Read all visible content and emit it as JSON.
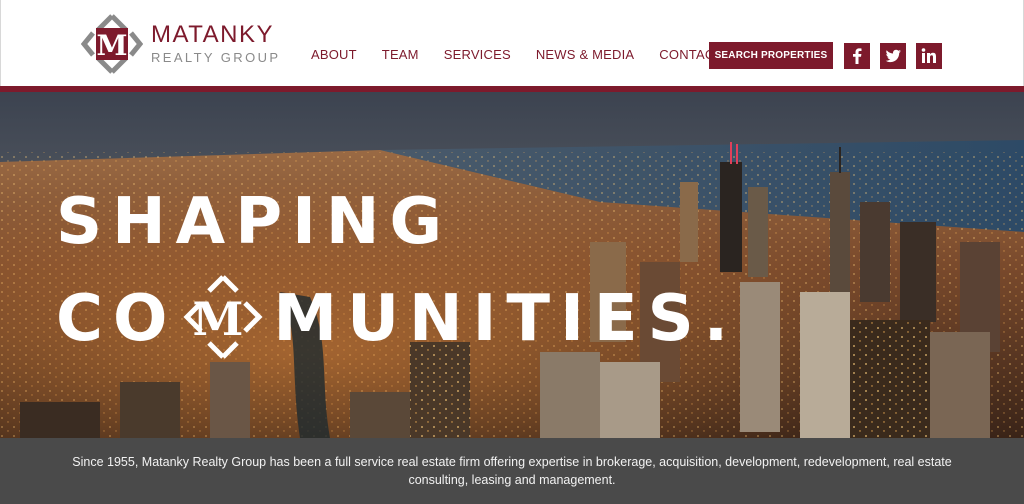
{
  "brand": {
    "name": "MATANKY",
    "subtitle": "REALTY GROUP",
    "logo_letter": "M",
    "primary_color": "#7d1a2c",
    "secondary_color": "#8a8a8a"
  },
  "nav": {
    "items": [
      {
        "label": "ABOUT"
      },
      {
        "label": "TEAM"
      },
      {
        "label": "SERVICES"
      },
      {
        "label": "NEWS & MEDIA"
      },
      {
        "label": "CONTACT"
      }
    ],
    "search_label": "SEARCH PROPERTIES"
  },
  "social": [
    {
      "icon": "facebook-icon",
      "glyph": "f"
    },
    {
      "icon": "twitter-icon",
      "glyph": "t"
    },
    {
      "icon": "linkedin-icon",
      "glyph": "in"
    }
  ],
  "hero": {
    "line1": "SHAPING",
    "line2_before": "CO",
    "line2_after": "MUNITIES.",
    "emblem_letter": "M"
  },
  "intro": {
    "text": "Since 1955, Matanky Realty Group has been a full service real estate firm offering expertise in brokerage, acquisition, development, redevelopment, real estate consulting, leasing and management."
  }
}
